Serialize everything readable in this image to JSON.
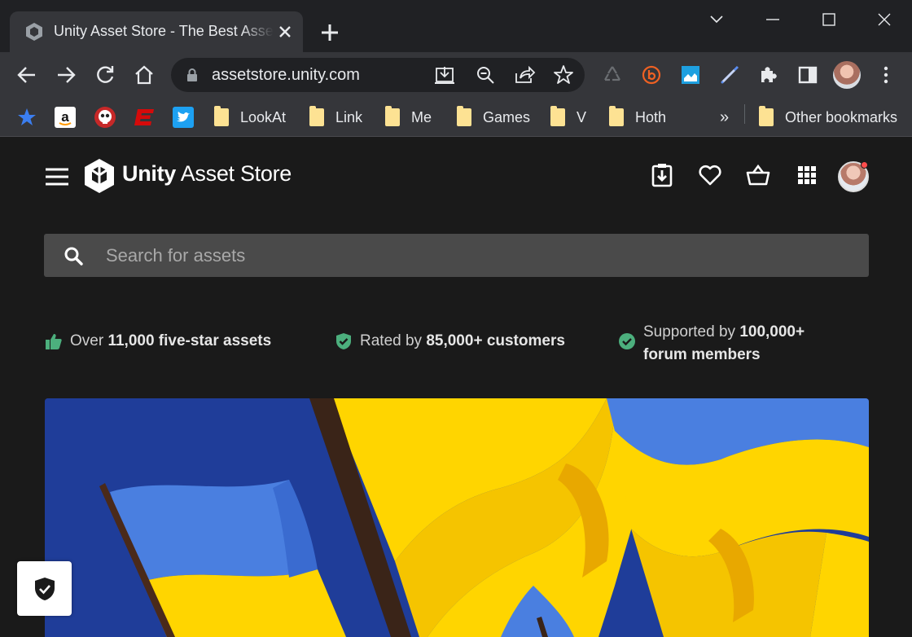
{
  "browser": {
    "tab": {
      "title": "Unity Asset Store - The Best Assets for Game Making"
    },
    "url": "assetstore.unity.com",
    "bookmarks": [
      {
        "label": "LookAt"
      },
      {
        "label": "Link"
      },
      {
        "label": "Me"
      },
      {
        "label": "Games"
      },
      {
        "label": "V"
      },
      {
        "label": "Hoth"
      }
    ],
    "bookmarks_overflow": "»",
    "other_bookmarks": "Other bookmarks"
  },
  "header": {
    "logo_bold": "Unity",
    "logo_rest": " Asset Store"
  },
  "search": {
    "placeholder": "Search for assets"
  },
  "features": [
    {
      "prefix": "Over ",
      "bold": "11,000 five-star assets"
    },
    {
      "prefix": "Rated by ",
      "bold": "85,000+ customers"
    },
    {
      "prefix": "Supported by ",
      "bold": "100,000+",
      "line2": "forum members"
    }
  ],
  "colors": {
    "accent_green": "#4caf7d",
    "hero_blue": "#1f3d99",
    "hero_yellow": "#ffd500",
    "flag_blue": "#4a7fe0"
  }
}
